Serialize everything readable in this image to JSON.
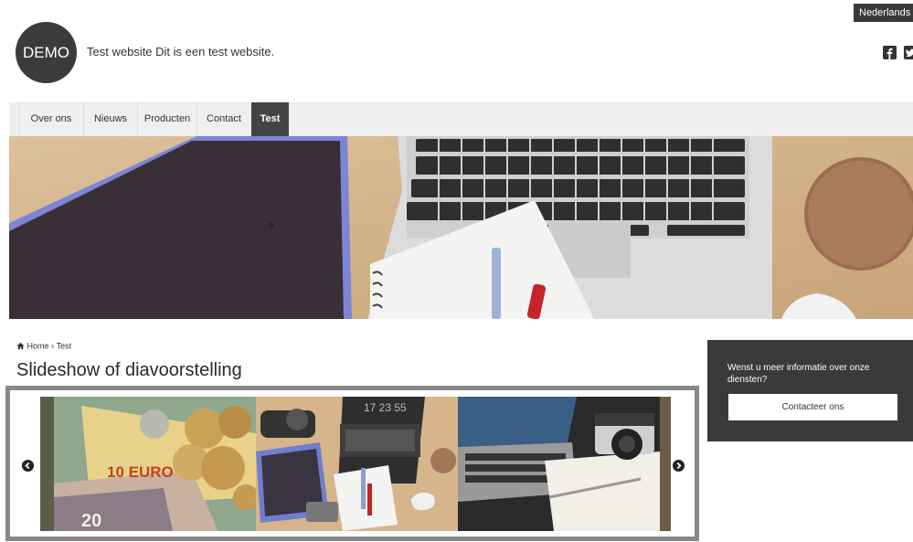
{
  "header": {
    "language": "Nederlands",
    "logo_text": "DEMO",
    "tagline": "Test website Dit is een test website.",
    "social_icons": [
      "facebook-icon",
      "twitter-icon"
    ]
  },
  "nav": {
    "items": [
      {
        "label": "Over ons",
        "active": false
      },
      {
        "label": "Nieuws",
        "active": false
      },
      {
        "label": "Producten",
        "active": false
      },
      {
        "label": "Contact",
        "active": false
      },
      {
        "label": "Test",
        "active": true
      }
    ]
  },
  "breadcrumb": {
    "home": "Home",
    "separator": "›",
    "current": "Test"
  },
  "main": {
    "title": "Slideshow of diavoorstelling"
  },
  "slideshow": {
    "prev_icon": "arrow-left-icon",
    "next_icon": "arrow-right-icon",
    "slides": [
      {
        "banknote_text": "10 EURO",
        "banknote_text_2": "20"
      },
      {
        "clock_text": "17 23 55"
      },
      {}
    ]
  },
  "sidebar": {
    "info_text": "Wenst u meer informatie over onze diensten?",
    "button_label": "Contacteer ons"
  },
  "colors": {
    "dark": "#3a3a3a",
    "nav_bg": "#efefef",
    "frame": "#888888"
  }
}
